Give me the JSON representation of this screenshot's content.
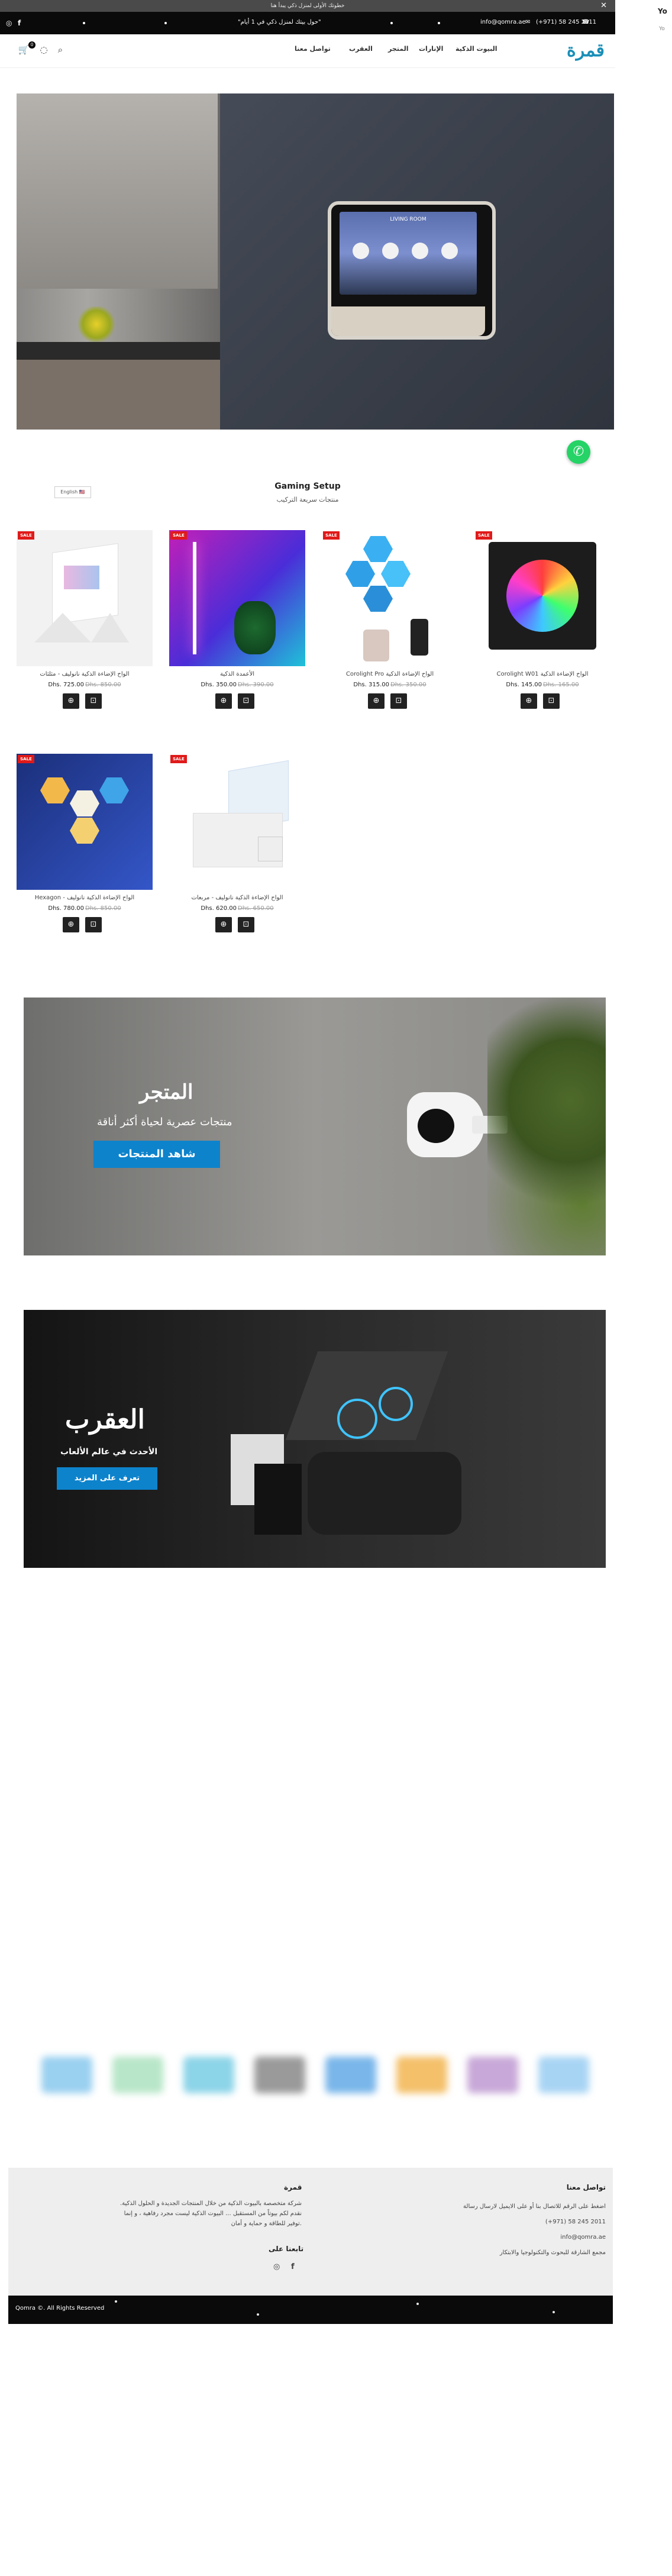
{
  "notice": {
    "text": "خطوتك الأولى لمنزل ذكي يبدأ هنا",
    "close": "✕"
  },
  "topbar": {
    "email": "info@qomra.ae",
    "phone": "(+971) 58 245 2011",
    "tagline": "\"حول بيتك لمنزل ذكي في 1 أيام\"",
    "social": [
      "instagram-icon",
      "facebook-icon"
    ]
  },
  "header": {
    "logo": "قمرة",
    "nav": [
      "البيوت الذكية",
      "الإنارات",
      "المتجر",
      "العقرب",
      "تواصل معنا"
    ],
    "cart_count": "0"
  },
  "hero": {
    "screen_title": "LIVING ROOM"
  },
  "language": {
    "label": "English"
  },
  "gaming": {
    "title": "Gaming Setup",
    "subtitle": "منتجات سريعة التركيب"
  },
  "products": [
    {
      "name": "الواح الإضاءة الذكية نانوليف - مثلثات",
      "price": "Dhs. 725.00",
      "old": "Dhs. 850.00",
      "sale": "SALE"
    },
    {
      "name": "الأعمدة الذكية",
      "price": "Dhs. 350.00",
      "old": "Dhs. 390.00",
      "sale": "SALE"
    },
    {
      "name": "Corolight Pro الواح الإضاءة الذكية",
      "price": "Dhs. 315.00",
      "old": "Dhs. 350.00",
      "sale": "SALE"
    },
    {
      "name": "Corolight W01 الواح الإضاءة الذكية",
      "price": "Dhs. 145.00",
      "old": "Dhs. 165.00",
      "sale": "SALE"
    },
    {
      "name": "Hexagon - الواح الإضاءة الذكية نانوليف",
      "price": "Dhs. 780.00",
      "old": "Dhs. 850.00",
      "sale": "SALE"
    },
    {
      "name": "الواح الإضاءة الذكية نانوليف - مربعات",
      "price": "Dhs. 620.00",
      "old": "Dhs. 650.00",
      "sale": "SALE"
    }
  ],
  "banner_store": {
    "title": "المتجر",
    "subtitle": "منتجات عصرية لحياة أكثر أناقة",
    "button": "شاهد المنتجات"
  },
  "banner_scorpion": {
    "title": "العقرب",
    "subtitle": "الأحدث في عالم الألعاب",
    "button": "تعرف على المزيد"
  },
  "footer": {
    "contact_title": "تواصل معنا",
    "contact_lines": [
      "اضغط على الرقم للاتصال بنا أو على الايميل لارسال رسالة",
      "(+971) 58 245 2011",
      "info@qomra.ae",
      "مجمع الشارقة للبحوث والتكنولوجيا والابتكار"
    ],
    "about_title": "قمرة",
    "about_text": "شركة متخصصة بالبيوت الذكية من خلال المنتجات الجديدة و الحلول الذكية. نقدم لكم بيوتاً من المستقبل ... البيوت الذكية ليست مجرد رفاهية ، و إنما توفير للطاقة و حماية و أمان.",
    "follow_title": "تابعنا على",
    "copyright": "Qomra ©. All Rights Reserved"
  },
  "side_panel": {
    "title": "Yo",
    "text": "Yo"
  },
  "colors": {
    "accent": "#0d83cc",
    "logo": "#1a8fb8",
    "sale": "#e01a1a",
    "whatsapp": "#25d366"
  }
}
